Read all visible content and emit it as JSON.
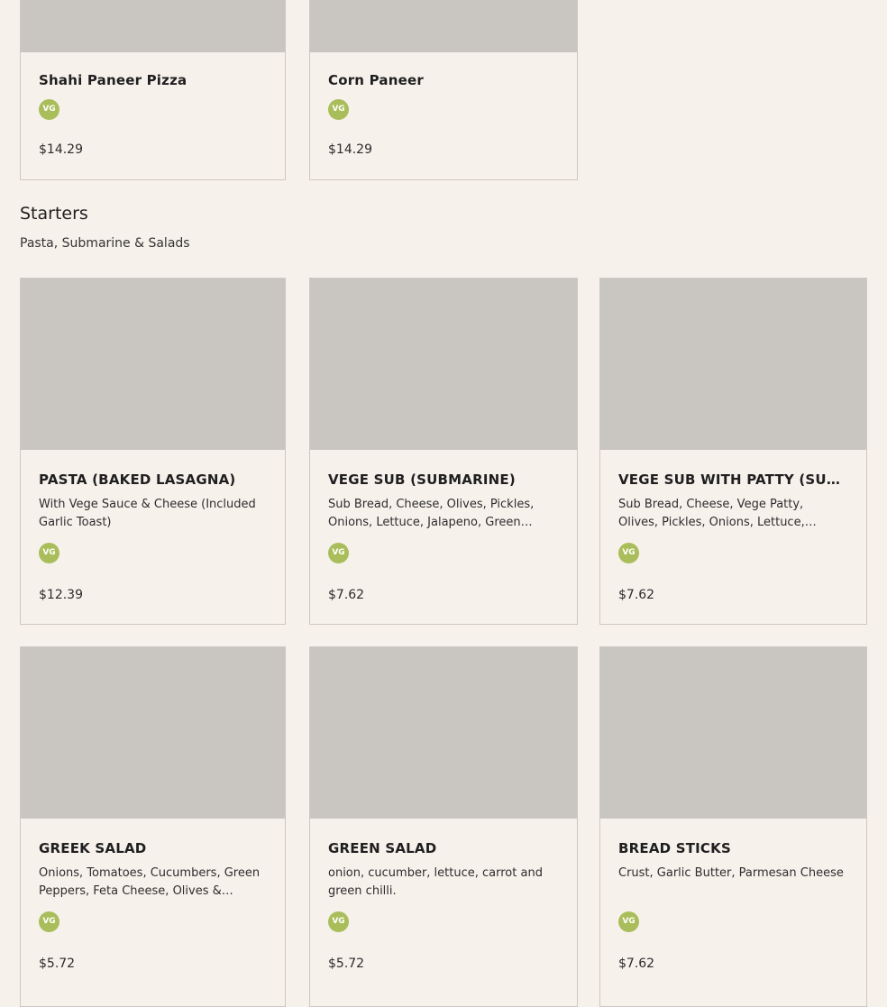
{
  "top_cards": [
    {
      "name": "Shahi Paneer Pizza",
      "badge": "VG",
      "price": "$14.29"
    },
    {
      "name": "Corn Paneer",
      "badge": "VG",
      "price": "$14.29"
    }
  ],
  "section": {
    "title": "Starters",
    "subtitle": "Pasta, Submarine & Salads"
  },
  "starters": [
    {
      "name": "PASTA (BAKED LASAGNA)",
      "description": "With Vege Sauce & Cheese (Included Garlic Toast)",
      "badge": "VG",
      "price": "$12.39"
    },
    {
      "name": "VEGE SUB (SUBMARINE)",
      "description": "Sub Bread, Cheese, Olives, Pickles, Onions, Lettuce, Jalapeno, Green…",
      "badge": "VG",
      "price": "$7.62"
    },
    {
      "name": "VEGE SUB WITH PATTY (SUBMARIN…",
      "description": "Sub Bread, Cheese, Vege Patty, Olives, Pickles, Onions, Lettuce, Jalapeno,…",
      "badge": "VG",
      "price": "$7.62"
    },
    {
      "name": "GREEK SALAD",
      "description": "Onions, Tomatoes, Cucumbers, Green Peppers, Feta Cheese, Olives & Gree…",
      "badge": "VG",
      "price": "$5.72"
    },
    {
      "name": "GREEN SALAD",
      "description": "onion, cucumber, lettuce, carrot and green chilli.",
      "badge": "VG",
      "price": "$5.72"
    },
    {
      "name": "BREAD STICKS",
      "description": "Crust, Garlic Butter, Parmesan Cheese",
      "badge": "VG",
      "price": "$7.62"
    }
  ],
  "colors": {
    "background": "#f7f1ec",
    "badge": "#a9be5a",
    "image_placeholder": "#c9c5c0"
  }
}
